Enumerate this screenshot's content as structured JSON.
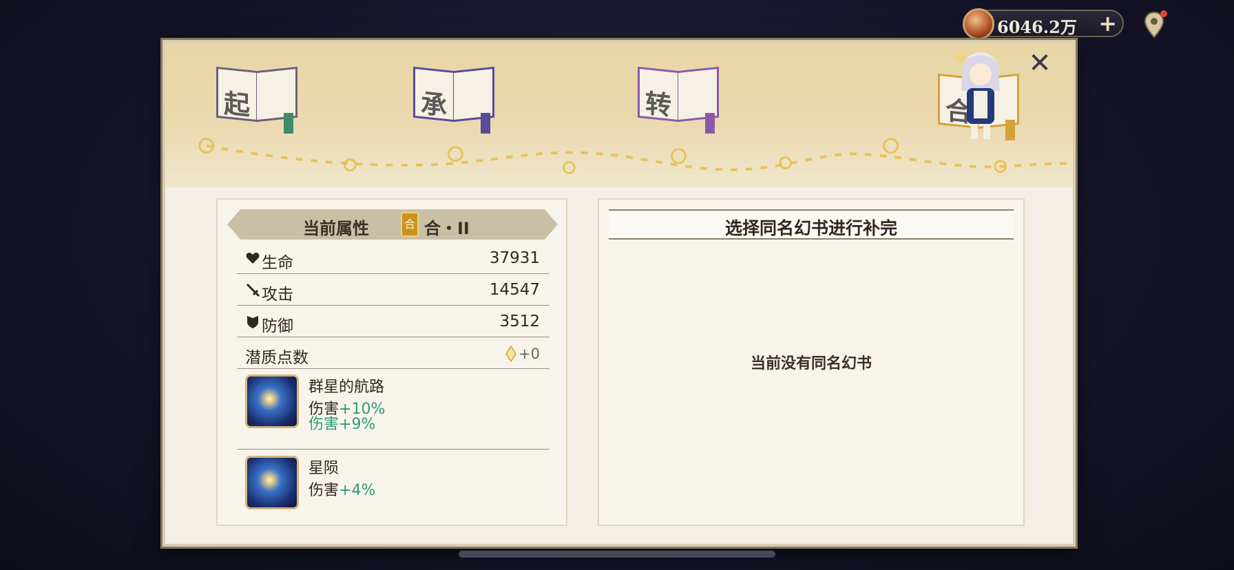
{
  "currency": {
    "value": "6046.2万",
    "plus": "+"
  },
  "stages": [
    {
      "char": "起",
      "ribbon_color": "#3f8a6a"
    },
    {
      "char": "承",
      "ribbon_color": "#5a4a9a"
    },
    {
      "char": "转",
      "ribbon_color": "#8a5aa8"
    },
    {
      "char": "合",
      "ribbon_color": "#d4a23a"
    }
  ],
  "close": "✕",
  "left_panel": {
    "header_title": "当前属性",
    "badge": "合",
    "tier": "合・II",
    "stats": [
      {
        "icon": "heart-icon",
        "label": "生命",
        "value": "37931"
      },
      {
        "icon": "sword-icon",
        "label": "攻击",
        "value": "14547"
      },
      {
        "icon": "shield-icon",
        "label": "防御",
        "value": "3512"
      }
    ],
    "potential": {
      "label": "潜质点数",
      "value": "+0"
    },
    "skills": [
      {
        "name": "群星的航路",
        "lines": [
          {
            "label": "伤害",
            "value": "+10%"
          },
          {
            "label": "伤害",
            "value": "+9%",
            "all_green": true
          }
        ]
      },
      {
        "name": "星陨",
        "lines": [
          {
            "label": "伤害",
            "value": "+4%"
          }
        ]
      }
    ]
  },
  "right_panel": {
    "title": "选择同名幻书进行补完",
    "empty_message": "当前没有同名幻书"
  },
  "colors": {
    "accent_green": "#2f9a78",
    "panel_bg": "#f7f4ec",
    "map_gold": "#e8d6a6"
  }
}
